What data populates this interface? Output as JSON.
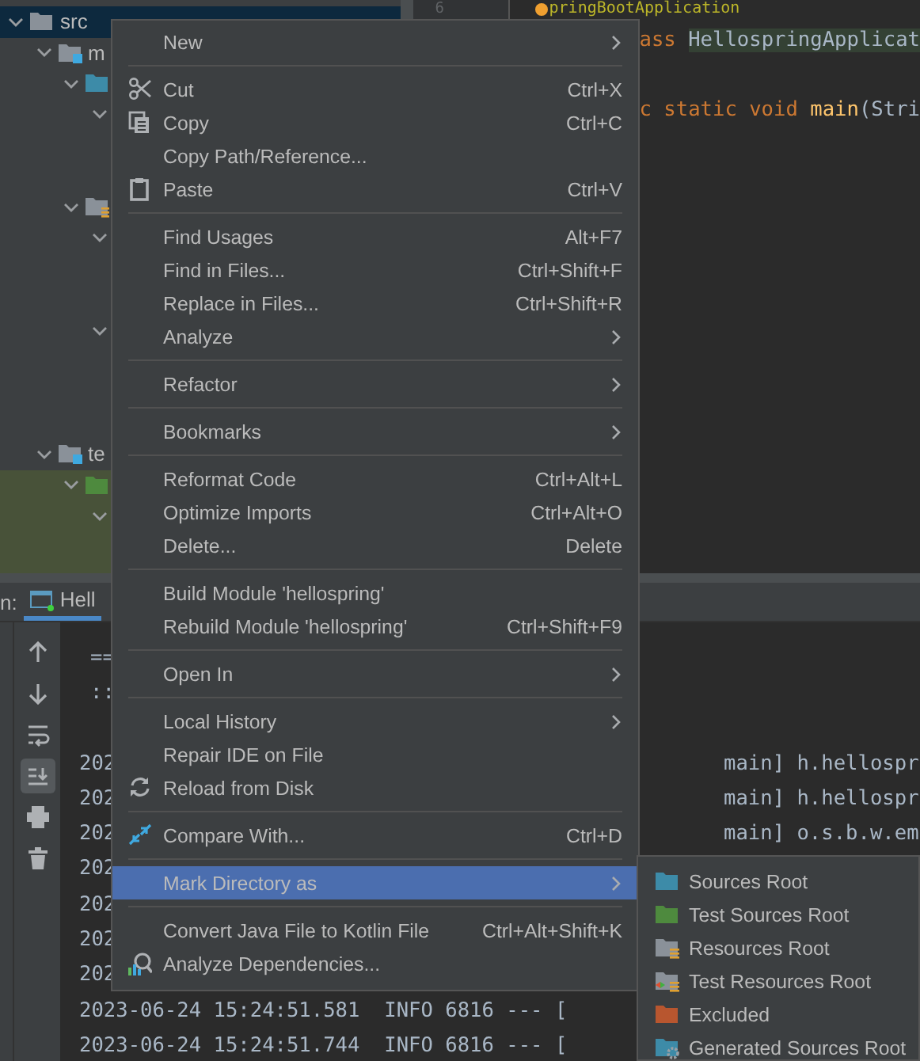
{
  "project_tree": [
    {
      "label": "src",
      "kind": "folder",
      "expanded": true,
      "selected": true,
      "children": [
        {
          "label": "m",
          "kind": "module",
          "expanded": true,
          "selected": false,
          "children": [
            {
              "kind": "sources",
              "expanded": true,
              "selected": false,
              "children": [
                {
                  "expanded": true,
                  "selected": false
                }
              ]
            },
            {
              "kind": "resources",
              "expanded": true,
              "selected": false,
              "children": [
                {
                  "expanded": true,
                  "selected": false
                },
                {
                  "expanded": true,
                  "selected": false
                }
              ]
            }
          ]
        },
        {
          "label": "te",
          "kind": "module",
          "expanded": true,
          "selected": false,
          "children": [
            {
              "kind": "test-sources",
              "expanded": true,
              "selected": false,
              "tinted": true,
              "children": [
                {
                  "expanded": true,
                  "selected": false,
                  "tinted": true
                }
              ]
            }
          ]
        }
      ]
    }
  ],
  "editor": {
    "line_number": "6",
    "lines": [
      {
        "marker": true,
        "tokens": [
          {
            "kind": "annotation",
            "text": "pringBootApplication"
          }
        ]
      },
      {
        "tokens": [
          {
            "kind": "keyword",
            "text": "ass "
          },
          {
            "kind": "class",
            "text": "HellospringApplicat"
          }
        ]
      },
      {
        "tokens": [
          {
            "kind": "keyword",
            "text": "c static void "
          },
          {
            "kind": "method",
            "text": "main"
          },
          {
            "kind": "plain",
            "text": "(Stri"
          }
        ]
      }
    ]
  },
  "run_panel": {
    "label": "n:",
    "tab": "Hell",
    "toolbar": [
      {
        "selected": false
      },
      {
        "selected": false
      },
      {
        "selected": false
      },
      {
        "selected": true
      },
      {
        "selected": false
      },
      {
        "selected": false
      }
    ],
    "console": [
      {
        "kind": "banner",
        "start": "=="
      },
      {
        "kind": "banner",
        "start": "::"
      },
      {
        "kind": "blank"
      },
      {
        "kind": "log",
        "start": "202",
        "end": "main] h.hellospr"
      },
      {
        "kind": "log",
        "start": "202",
        "end": "main] h.hellospr"
      },
      {
        "kind": "log",
        "start": "202",
        "end": "main] o.s.b.w.em"
      },
      {
        "kind": "log",
        "start": "202"
      },
      {
        "kind": "log",
        "start": "202"
      },
      {
        "kind": "log",
        "start": "202"
      },
      {
        "kind": "log",
        "start": "202"
      },
      {
        "kind": "log",
        "start": "2023-06-24 15:24:51.581  INFO 6816 --- ["
      },
      {
        "kind": "log",
        "start": "2023-06-24 15:24:51.744  INFO 6816 --- ["
      }
    ]
  },
  "context_menu": {
    "groups": [
      {
        "items": [
          {
            "label": "New",
            "submenu": true,
            "selected": false
          }
        ]
      },
      {
        "items": [
          {
            "label": "Cut",
            "shortcut": "Ctrl+X",
            "selected": false
          },
          {
            "label": "Copy",
            "shortcut": "Ctrl+C",
            "selected": false
          },
          {
            "label": "Copy Path/Reference...",
            "selected": false
          },
          {
            "label": "Paste",
            "shortcut": "Ctrl+V",
            "selected": false
          }
        ]
      },
      {
        "items": [
          {
            "label": "Find Usages",
            "shortcut": "Alt+F7",
            "selected": false
          },
          {
            "label": "Find in Files...",
            "shortcut": "Ctrl+Shift+F",
            "selected": false
          },
          {
            "label": "Replace in Files...",
            "shortcut": "Ctrl+Shift+R",
            "selected": false
          },
          {
            "label": "Analyze",
            "submenu": true,
            "selected": false
          }
        ]
      },
      {
        "items": [
          {
            "label": "Refactor",
            "submenu": true,
            "selected": false
          }
        ]
      },
      {
        "items": [
          {
            "label": "Bookmarks",
            "submenu": true,
            "selected": false
          }
        ]
      },
      {
        "items": [
          {
            "label": "Reformat Code",
            "shortcut": "Ctrl+Alt+L",
            "selected": false
          },
          {
            "label": "Optimize Imports",
            "shortcut": "Ctrl+Alt+O",
            "selected": false
          },
          {
            "label": "Delete...",
            "shortcut": "Delete",
            "selected": false
          }
        ]
      },
      {
        "items": [
          {
            "label": "Build Module 'hellospring'",
            "selected": false
          },
          {
            "label": "Rebuild Module 'hellospring'",
            "shortcut": "Ctrl+Shift+F9",
            "selected": false
          }
        ]
      },
      {
        "items": [
          {
            "label": "Open In",
            "submenu": true,
            "selected": false
          }
        ]
      },
      {
        "items": [
          {
            "label": "Local History",
            "submenu": true,
            "selected": false
          },
          {
            "label": "Repair IDE on File",
            "selected": false
          },
          {
            "label": "Reload from Disk",
            "selected": false
          }
        ]
      },
      {
        "items": [
          {
            "label": "Compare With...",
            "shortcut": "Ctrl+D",
            "selected": false
          }
        ]
      },
      {
        "items": [
          {
            "label": "Mark Directory as",
            "submenu": true,
            "selected": true
          }
        ]
      },
      {
        "items": [
          {
            "label": "Convert Java File to Kotlin File",
            "shortcut": "Ctrl+Alt+Shift+K",
            "selected": false
          },
          {
            "label": "Analyze Dependencies...",
            "selected": false
          }
        ]
      }
    ]
  },
  "submenu": {
    "items": [
      {
        "label": "Sources Root",
        "kind": "plain",
        "color": "#3d8ba8",
        "selected": false
      },
      {
        "label": "Test Sources Root",
        "kind": "plain",
        "color": "#4e8a3e",
        "selected": false
      },
      {
        "label": "Resources Root",
        "kind": "resources",
        "color": "#8a9199",
        "selected": false
      },
      {
        "label": "Test Resources Root",
        "kind": "test-resources",
        "color": "#8a9199",
        "selected": false
      },
      {
        "label": "Excluded",
        "kind": "plain",
        "color": "#b8562f",
        "selected": false
      },
      {
        "label": "Generated Sources Root",
        "kind": "generated",
        "color": "#3d8ba8",
        "selected": false
      }
    ]
  }
}
